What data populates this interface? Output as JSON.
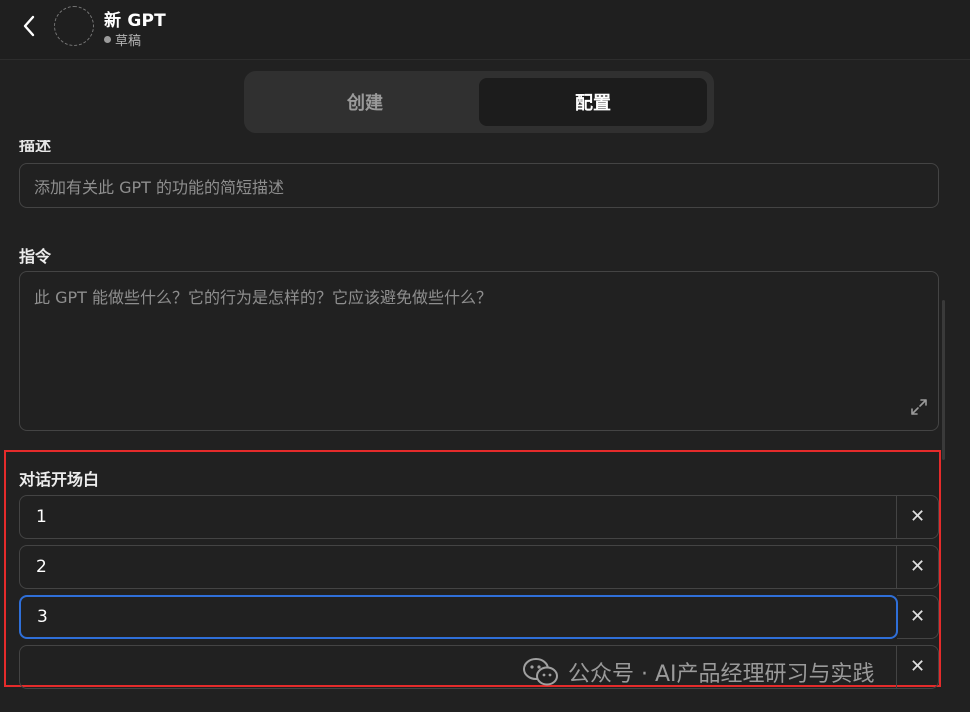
{
  "header": {
    "title": "新 GPT",
    "status": "草稿"
  },
  "tabs": [
    {
      "label": "创建",
      "active": false
    },
    {
      "label": "配置",
      "active": true
    }
  ],
  "description": {
    "label": "描述",
    "placeholder": "添加有关此 GPT 的功能的简短描述"
  },
  "instructions": {
    "label": "指令",
    "placeholder": "此 GPT 能做些什么？它的行为是怎样的？它应该避免做些什么？"
  },
  "conversation_starters": {
    "label": "对话开场白",
    "items": [
      {
        "value": "1"
      },
      {
        "value": "2"
      },
      {
        "value": "3"
      },
      {
        "value": ""
      }
    ]
  },
  "watermark": {
    "text": "公众号 · AI产品经理研习与实践"
  },
  "colors": {
    "background": "#212121",
    "highlight_box": "#e52b2b",
    "focus_ring": "#2f6fd8"
  }
}
